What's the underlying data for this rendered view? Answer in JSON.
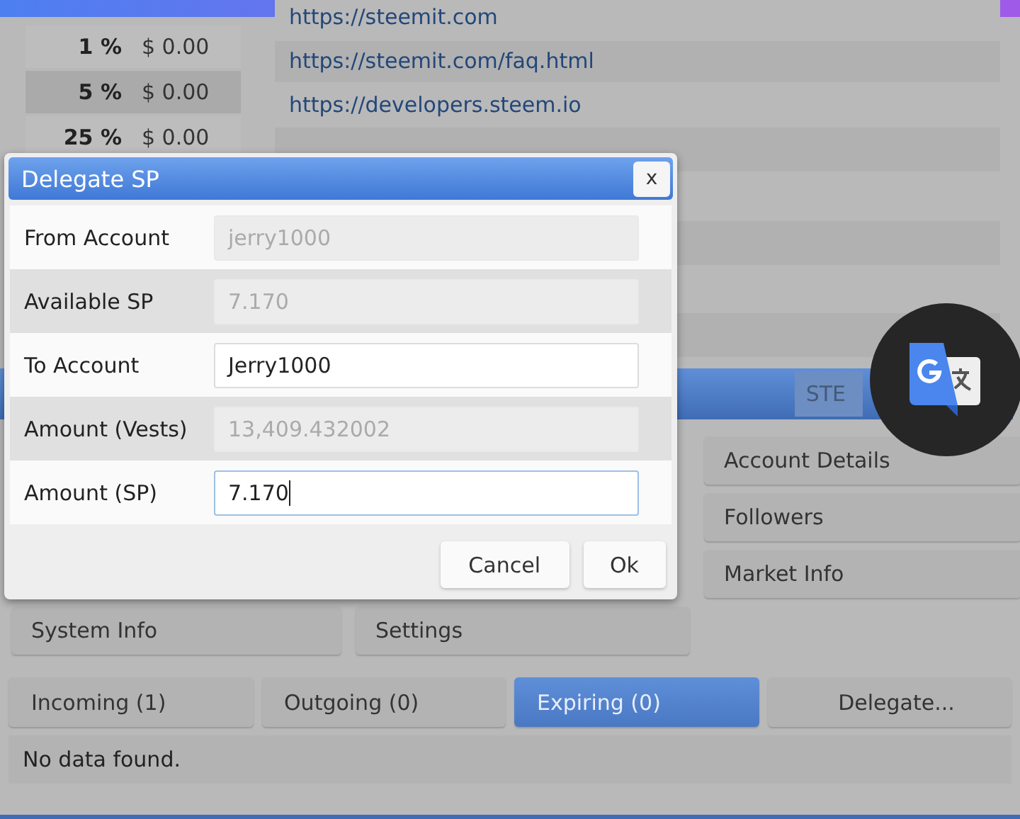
{
  "fee_table": {
    "rows": [
      {
        "percent": "1 %",
        "amount": "$ 0.00",
        "selected": false
      },
      {
        "percent": "5 %",
        "amount": "$ 0.00",
        "selected": true
      },
      {
        "percent": "25 %",
        "amount": "$ 0.00",
        "selected": false
      }
    ]
  },
  "links": [
    "https://steemit.com",
    "https://steemit.com/faq.html",
    "https://developers.steem.io"
  ],
  "header_bar": {
    "button": "STE"
  },
  "menu": {
    "right_column": [
      "Account Details",
      "Followers",
      "Market Info"
    ],
    "bottom_row": [
      "System Info",
      "Settings"
    ]
  },
  "tabs": [
    {
      "label": "Incoming (1)",
      "selected": false
    },
    {
      "label": "Outgoing (0)",
      "selected": false
    },
    {
      "label": "Expiring (0)",
      "selected": true
    },
    {
      "label": "Delegate...",
      "selected": false
    }
  ],
  "status": "No data found.",
  "dialog": {
    "title": "Delegate SP",
    "close": "x",
    "fields": [
      {
        "label": "From Account",
        "value": "jerry1000",
        "disabled": true,
        "focused": false
      },
      {
        "label": "Available SP",
        "value": "7.170",
        "disabled": true,
        "focused": false
      },
      {
        "label": "To Account",
        "value": "Jerry1000",
        "disabled": false,
        "focused": false
      },
      {
        "label": "Amount (Vests)",
        "value": "13,409.432002",
        "disabled": true,
        "focused": false
      },
      {
        "label": "Amount (SP)",
        "value": "7.170",
        "disabled": false,
        "focused": true
      }
    ],
    "buttons": [
      "Cancel",
      "Ok"
    ]
  }
}
